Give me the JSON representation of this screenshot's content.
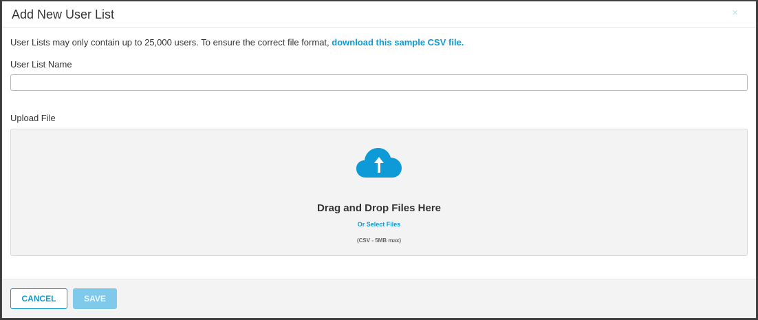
{
  "modal": {
    "title": "Add New User List",
    "close_label": "×"
  },
  "intro": {
    "text": "User Lists may only contain up to 25,000 users. To ensure the correct file format, ",
    "link_text": "download this sample CSV file."
  },
  "form": {
    "name_label": "User List Name",
    "name_value": "",
    "name_placeholder": "",
    "upload_label": "Upload File"
  },
  "dropzone": {
    "icon": "cloud-upload-icon",
    "title": "Drag and Drop Files Here",
    "select_link": "Or Select Files",
    "hint": "(CSV - 5MB max)"
  },
  "footer": {
    "cancel_label": "CANCEL",
    "save_label": "SAVE"
  },
  "colors": {
    "accent": "#0d9ad6",
    "save_disabled": "#7fc9ea",
    "dropzone_bg": "#f3f3f3"
  }
}
